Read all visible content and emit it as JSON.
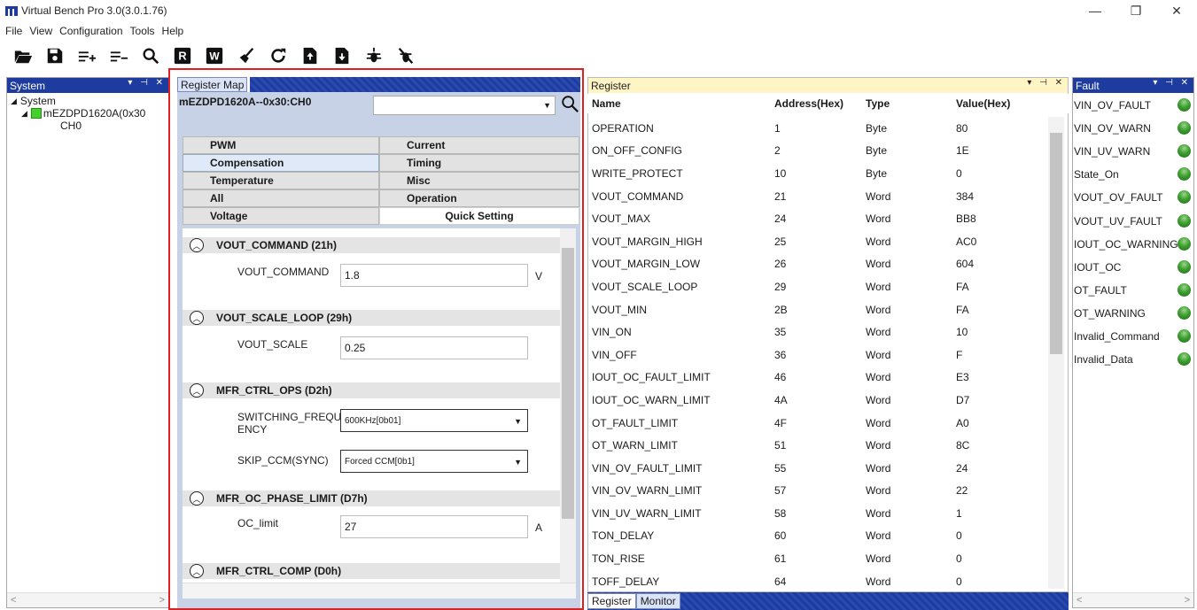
{
  "window": {
    "title": "Virtual Bench Pro 3.0(3.0.1.76)",
    "controls": [
      "—",
      "❐",
      "✕"
    ]
  },
  "menu": [
    "File",
    "View",
    "Configuration",
    "Tools",
    "Help"
  ],
  "toolbar": [
    {
      "icon": "folder-open-icon"
    },
    {
      "icon": "save-icon"
    },
    {
      "icon": "add-list-icon"
    },
    {
      "icon": "remove-list-icon"
    },
    {
      "icon": "search-icon"
    },
    {
      "icon": "read-icon",
      "letter": "R"
    },
    {
      "icon": "write-icon",
      "letter": "W"
    },
    {
      "icon": "clear-icon"
    },
    {
      "icon": "refresh-icon"
    },
    {
      "icon": "import-icon"
    },
    {
      "icon": "export-icon"
    },
    {
      "icon": "debug-icon"
    },
    {
      "icon": "debug-off-icon"
    }
  ],
  "system_panel": {
    "title": "System",
    "tree": [
      {
        "label": "System",
        "indent": 0
      },
      {
        "label": "mEZDPD1620A(0x30",
        "indent": 1
      },
      {
        "label": "CH0",
        "indent": 2
      }
    ]
  },
  "register_map": {
    "tab": "Register Map",
    "device": "mEZDPD1620A--0x30:CH0",
    "categories": [
      {
        "label": "PWM",
        "state": "normal"
      },
      {
        "label": "Current",
        "state": "normal"
      },
      {
        "label": "Compensation",
        "state": "selected"
      },
      {
        "label": "Timing",
        "state": "normal"
      },
      {
        "label": "Temperature",
        "state": "normal"
      },
      {
        "label": "Misc",
        "state": "normal"
      },
      {
        "label": "All",
        "state": "normal"
      },
      {
        "label": "Operation",
        "state": "normal"
      },
      {
        "label": "Voltage",
        "state": "normal"
      },
      {
        "label": "Quick Setting",
        "state": "active"
      }
    ],
    "sections": [
      {
        "title": "VOUT_COMMAND  (21h)",
        "fields": [
          {
            "label": "VOUT_COMMAND",
            "value": "1.8",
            "unit": "V",
            "kind": "input"
          }
        ]
      },
      {
        "title": "VOUT_SCALE_LOOP  (29h)",
        "fields": [
          {
            "label": "VOUT_SCALE",
            "value": "0.25",
            "unit": "",
            "kind": "input"
          }
        ]
      },
      {
        "title": "MFR_CTRL_OPS  (D2h)",
        "fields": [
          {
            "label": "SWITCHING_FREQU\nENCY",
            "value": "600KHz[0b01]",
            "unit": "",
            "kind": "select"
          },
          {
            "label": "SKIP_CCM(SYNC)",
            "value": "Forced CCM[0b1]",
            "unit": "",
            "kind": "select"
          }
        ]
      },
      {
        "title": "MFR_OC_PHASE_LIMIT  (D7h)",
        "fields": [
          {
            "label": "OC_limit",
            "value": "27",
            "unit": "A",
            "kind": "input"
          }
        ]
      },
      {
        "title": "MFR_CTRL_COMP  (D0h)",
        "fields": []
      }
    ]
  },
  "register_panel": {
    "title": "Register",
    "columns": [
      "Name",
      "Address(Hex)",
      "Type",
      "Value(Hex)"
    ],
    "rows": [
      [
        "OPERATION",
        "1",
        "Byte",
        "80"
      ],
      [
        "ON_OFF_CONFIG",
        "2",
        "Byte",
        "1E"
      ],
      [
        "WRITE_PROTECT",
        "10",
        "Byte",
        "0"
      ],
      [
        "VOUT_COMMAND",
        "21",
        "Word",
        "384"
      ],
      [
        "VOUT_MAX",
        "24",
        "Word",
        "BB8"
      ],
      [
        "VOUT_MARGIN_HIGH",
        "25",
        "Word",
        "AC0"
      ],
      [
        "VOUT_MARGIN_LOW",
        "26",
        "Word",
        "604"
      ],
      [
        "VOUT_SCALE_LOOP",
        "29",
        "Word",
        "FA"
      ],
      [
        "VOUT_MIN",
        "2B",
        "Word",
        "FA"
      ],
      [
        "VIN_ON",
        "35",
        "Word",
        "10"
      ],
      [
        "VIN_OFF",
        "36",
        "Word",
        "F"
      ],
      [
        "IOUT_OC_FAULT_LIMIT",
        "46",
        "Word",
        "E3"
      ],
      [
        "IOUT_OC_WARN_LIMIT",
        "4A",
        "Word",
        "D7"
      ],
      [
        "OT_FAULT_LIMIT",
        "4F",
        "Word",
        "A0"
      ],
      [
        "OT_WARN_LIMIT",
        "51",
        "Word",
        "8C"
      ],
      [
        "VIN_OV_FAULT_LIMIT",
        "55",
        "Word",
        "24"
      ],
      [
        "VIN_OV_WARN_LIMIT",
        "57",
        "Word",
        "22"
      ],
      [
        "VIN_UV_WARN_LIMIT",
        "58",
        "Word",
        "1"
      ],
      [
        "TON_DELAY",
        "60",
        "Word",
        "0"
      ],
      [
        "TON_RISE",
        "61",
        "Word",
        "0"
      ],
      [
        "TOFF_DELAY",
        "64",
        "Word",
        "0"
      ]
    ],
    "bottom_tabs": [
      "Register",
      "Monitor"
    ]
  },
  "fault_panel": {
    "title": "Fault",
    "items": [
      "VIN_OV_FAULT",
      "VIN_OV_WARN",
      "VIN_UV_WARN",
      "State_On",
      "VOUT_OV_FAULT",
      "VOUT_UV_FAULT",
      "IOUT_OC_WARNING",
      "IOUT_OC",
      "OT_FAULT",
      "OT_WARNING",
      "Invalid_Command",
      "Invalid_Data"
    ],
    "led_color": "#3f9f32"
  },
  "theme": {
    "accent": "#1e3c9f",
    "highlight_border": "#e02020",
    "register_header": "#fff4c4"
  }
}
